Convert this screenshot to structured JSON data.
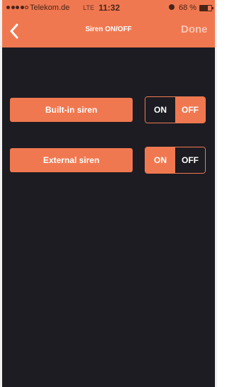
{
  "status_bar": {
    "carrier": "Telekom.de",
    "network": "LTE",
    "time": "11:32",
    "battery": "68 %"
  },
  "nav": {
    "title": "Siren ON/OFF",
    "done_label": "Done"
  },
  "settings": [
    {
      "label": "Built-in siren",
      "on_label": "ON",
      "off_label": "OFF",
      "selected": "ON"
    },
    {
      "label": "External siren",
      "on_label": "ON",
      "off_label": "OFF",
      "selected": "OFF"
    }
  ],
  "colors": {
    "accent": "#f07850",
    "background": "#1d1c22"
  }
}
